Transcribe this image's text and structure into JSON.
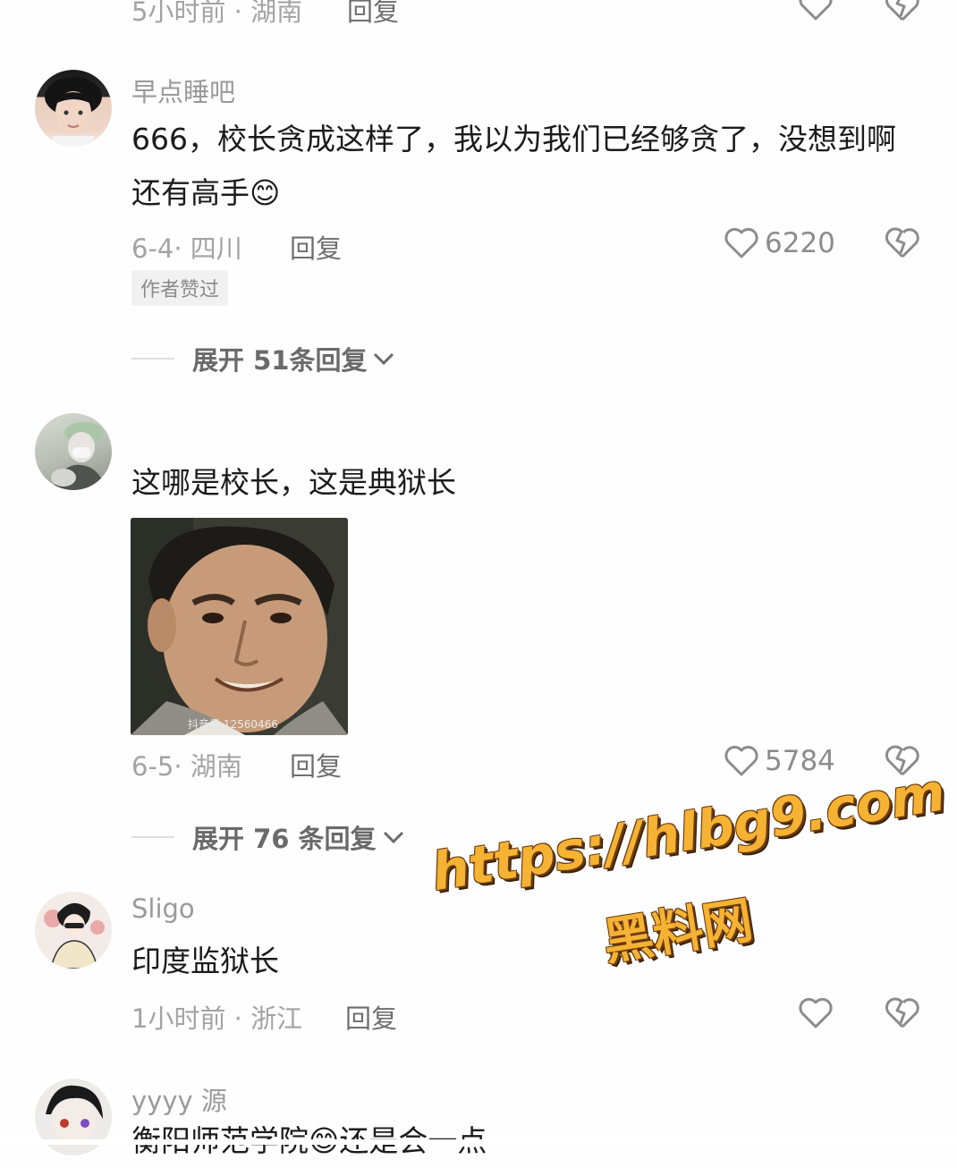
{
  "comments": [
    {
      "meta": "5小时前 · 湖南",
      "reply_label": "回复"
    },
    {
      "username": "早点睡吧",
      "text": "666，校长贪成这样了，我以为我们已经够贪了，没想到啊还有高手😊",
      "meta": "6-4· 四川",
      "reply_label": "回复",
      "likes": "6220",
      "badge": "作者赞过",
      "expand_label": "展开 51条回复"
    },
    {
      "text": "这哪是校长，这是典狱长",
      "image_watermark": "抖音号 12560466",
      "meta": "6-5· 湖南",
      "reply_label": "回复",
      "likes": "5784",
      "expand_label": "展开 76 条回复"
    },
    {
      "username": "Sligo",
      "text": "印度监狱长",
      "meta": "1小时前 · 浙江",
      "reply_label": "回复"
    },
    {
      "username": "yyyy 源",
      "text": "衡阳师范学院😊还是会一点"
    }
  ],
  "watermark": {
    "url": "https://hlbg9.com",
    "name": "黑料网"
  }
}
